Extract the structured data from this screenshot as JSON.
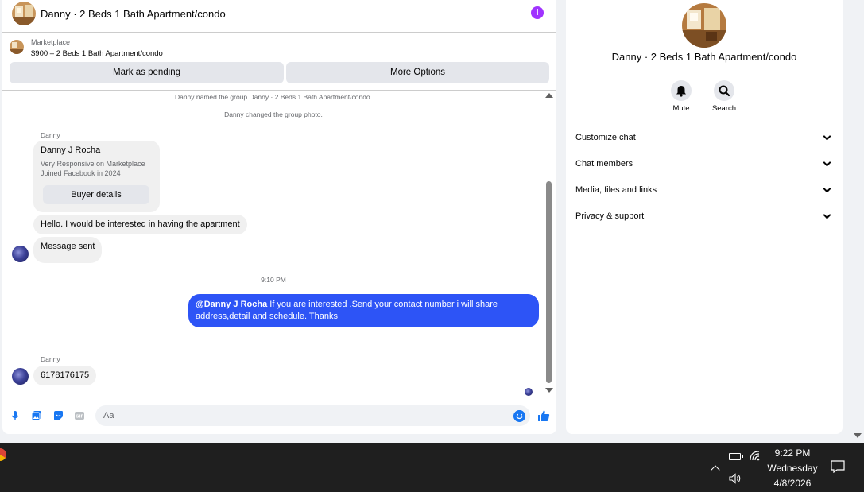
{
  "chat": {
    "title": "Danny · 2 Beds 1 Bath Apartment/condo",
    "marketplace": {
      "label": "Marketplace",
      "listing": "$900 – 2 Beds 1 Bath Apartment/condo",
      "mark_pending_label": "Mark as pending",
      "more_options_label": "More Options"
    },
    "system_messages": [
      "Danny named the group Danny · 2 Beds 1 Bath Apartment/condo.",
      "Danny changed the group photo."
    ],
    "buyer_card": {
      "sender": "Danny",
      "name": "Danny J Rocha",
      "line1": "Very Responsive on Marketplace",
      "line2": "Joined Facebook in 2024",
      "button_label": "Buyer details"
    },
    "incoming_1": "Hello. I would be interested in having the apartment",
    "incoming_2": "Message sent",
    "time_divider": "9:10 PM",
    "outgoing": {
      "mention": "@Danny J Rocha",
      "text": " If you are interested .Send your contact number i will share address,detail and schedule. Thanks"
    },
    "incoming_3_sender": "Danny",
    "incoming_3": "6178176175",
    "composer": {
      "placeholder": "Aa"
    }
  },
  "info_panel": {
    "title": "Danny · 2 Beds 1 Bath Apartment/condo",
    "actions": [
      {
        "label": "Mute",
        "icon": "bell-icon"
      },
      {
        "label": "Search",
        "icon": "search-icon"
      }
    ],
    "sections": [
      "Customize chat",
      "Chat members",
      "Media, files and links",
      "Privacy & support"
    ]
  },
  "taskbar": {
    "time": "9:22 PM",
    "day": "Wednesday",
    "date": "4/8/2026"
  },
  "colors": {
    "accent": "#2d54f6",
    "messenger_blue": "#1877f2",
    "info_purple": "#a033ff",
    "taskbar": "#1f1f1f"
  }
}
